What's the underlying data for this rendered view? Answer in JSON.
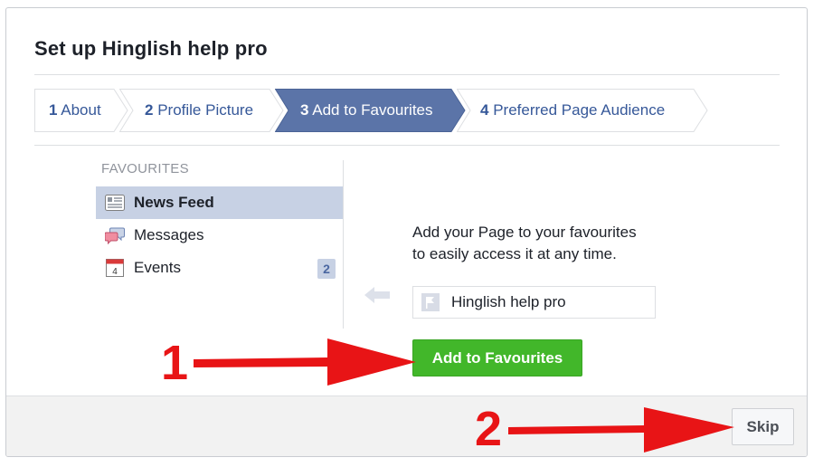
{
  "dialog": {
    "title": "Set up Hinglish help pro",
    "steps": [
      {
        "num": "1",
        "label": "About",
        "active": false
      },
      {
        "num": "2",
        "label": "Profile Picture",
        "active": false
      },
      {
        "num": "3",
        "label": "Add to Favourites",
        "active": true
      },
      {
        "num": "4",
        "label": "Preferred Page Audience",
        "active": false
      }
    ]
  },
  "favourites": {
    "heading": "FAVOURITES",
    "items": [
      {
        "label": "News Feed",
        "icon": "news-feed-icon",
        "selected": true
      },
      {
        "label": "Messages",
        "icon": "messages-icon",
        "selected": false
      },
      {
        "label": "Events",
        "icon": "calendar-icon",
        "calendar_day": "4",
        "badge": "2",
        "selected": false
      }
    ]
  },
  "content": {
    "description_line1": "Add your Page to your favourites",
    "description_line2": "to easily access it at any time.",
    "page_name": "Hinglish help pro",
    "add_button": "Add to Favourites"
  },
  "footer": {
    "skip_button": "Skip"
  },
  "annotations": {
    "marker1": "1",
    "marker2": "2",
    "color": "#e81416"
  },
  "colors": {
    "active_step": "#5b74a8",
    "link": "#365899",
    "add_button": "#42b72a"
  }
}
